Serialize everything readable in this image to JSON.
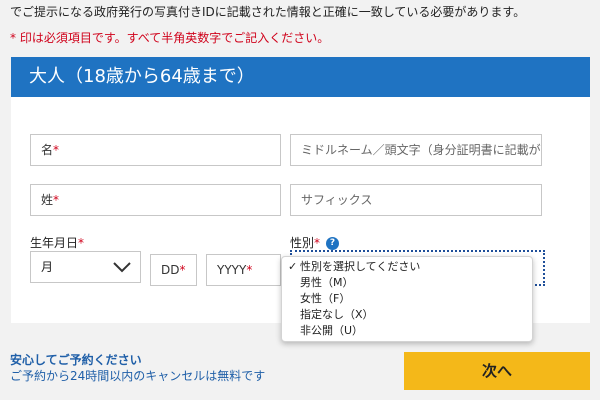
{
  "intro_text": "でご提示になる政府発行の写真付きIDに記載された情報と正確に一致している必要があります。",
  "required_note": "* 印は必須項目です。すべて半角英数字でご記入ください。",
  "section_title": "大人（18歳から64歳まで）",
  "fields": {
    "first_name": "名",
    "middle_name": "ミドルネーム／頭文字（身分証明書に記載が...",
    "last_name": "姓",
    "suffix": "サフィックス",
    "birthdate_label": "生年月日",
    "month": "月",
    "day": "DD",
    "year": "YYYY",
    "gender_label": "性別",
    "help_icon_text": "?"
  },
  "required_mark": "*",
  "gender_options": [
    {
      "label": "性別を選択してください",
      "selected": true
    },
    {
      "label": "男性（M）",
      "selected": false
    },
    {
      "label": "女性（F）",
      "selected": false
    },
    {
      "label": "指定なし（X）",
      "selected": false
    },
    {
      "label": "非公開（U）",
      "selected": false
    }
  ],
  "check_mark": "✓",
  "reassure_title": "安心してご予約ください",
  "reassure_sub": "ご予約から24時間以内のキャンセルは無料です",
  "next_button": "次へ",
  "colors": {
    "header": "#1f73c2",
    "required": "#d0021b",
    "button": "#f4b819",
    "link": "#1f5fa8"
  }
}
